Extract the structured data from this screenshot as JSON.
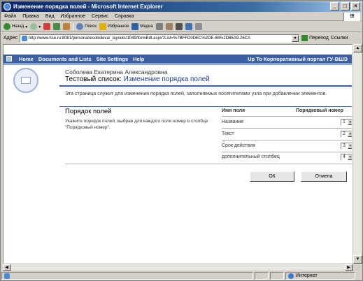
{
  "window": {
    "title": "Изменение порядка полей - Microsoft Internet Explorer",
    "buttons": [
      "_",
      "□",
      "×"
    ]
  },
  "menu": [
    "Файл",
    "Правка",
    "Вид",
    "Избранное",
    "Сервис",
    "Справка"
  ],
  "toolbar": {
    "back": "Назад",
    "search": "Поиск",
    "favorites": "Избранное",
    "media": "Медиа"
  },
  "address": {
    "label": "Адрес",
    "url": "http://www.hse.ru:8081/personal/esoboleva/_layouts/1049/formEdt.aspx?List=%7BFFD0DEC%2DE-88%2D86A9-26CA",
    "go": "Переход",
    "links": "Ссылки"
  },
  "sharepoint": {
    "nav": [
      "Home",
      "Documents and Lists",
      "Site Settings",
      "Help"
    ],
    "up_link": "Up To Корпоративный портал ГУ-ВШЭ",
    "user": "Соболева Екатерина Александровна",
    "list_name": "Тестовый список:",
    "page_title": "Изменение порядка полей",
    "description": "Эта страница служит для изменения порядка полей, заполняемых посетителями узла при добавлении элементов.",
    "section_title": "Порядок полей",
    "section_desc": "Укажите порядок полей, выбрав для каждого поля номер в столбце \"Порядковый номер\".",
    "col_name": "Имя поля",
    "col_order": "Порядковый номер",
    "fields": [
      {
        "name": "Название",
        "order": "1"
      },
      {
        "name": "Текст",
        "order": "2"
      },
      {
        "name": "Срок действия",
        "order": "3"
      },
      {
        "name": "дополнительный столбец",
        "order": "4"
      }
    ],
    "ok": "ОК",
    "cancel": "Отмена"
  },
  "status": {
    "zone": "Интернет"
  }
}
